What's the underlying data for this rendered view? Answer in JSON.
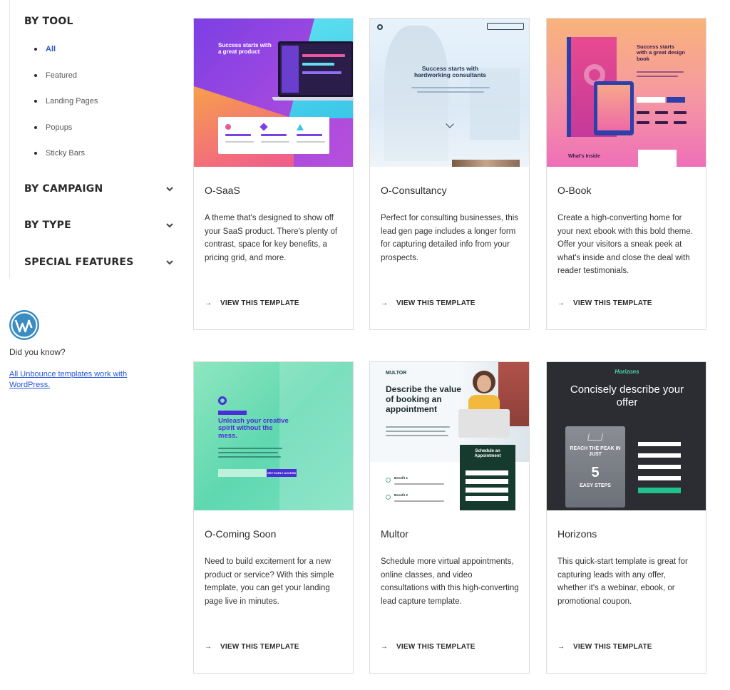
{
  "sidebar": {
    "by_tool": {
      "title": "BY TOOL",
      "items": [
        "All",
        "Featured",
        "Landing Pages",
        "Popups",
        "Sticky Bars"
      ]
    },
    "sections": [
      "BY CAMPAIGN",
      "BY TYPE",
      "SPECIAL FEATURES"
    ]
  },
  "promo": {
    "heading": "Did you know?",
    "link": "All Unbounce templates work with WordPress."
  },
  "colors": {
    "link_blue": "#2a57d6",
    "border": "#dcdcdc"
  },
  "cards": [
    {
      "title": "O-SaaS",
      "desc": "A theme that's designed to show off your SaaS product. There's plenty of contrast, space for key benefits, a pricing grid, and more.",
      "link": "VIEW THIS TEMPLATE",
      "thumb": {
        "headline": "Success starts with a great product"
      }
    },
    {
      "title": "O-Consultancy",
      "desc": "Perfect for consulting businesses, this lead gen page includes a longer form for capturing detailed info from your prospects.",
      "link": "VIEW THIS TEMPLATE",
      "thumb": {
        "headline": "Success starts with hardworking consultants"
      }
    },
    {
      "title": "O-Book",
      "desc": "Create a high-converting home for your next ebook with this bold theme. Offer your visitors a sneak peek at what's inside and close the deal with reader testimonials.",
      "link": "VIEW THIS TEMPLATE",
      "thumb": {
        "headline": "Success starts with a great design book",
        "sub": "What's Inside"
      }
    },
    {
      "title": "O-Coming Soon",
      "desc": "Need to build excitement for a new product or service? With this simple template, you can get your landing page live in minutes.",
      "link": "VIEW THIS TEMPLATE",
      "thumb": {
        "headline": "Unleash your creative spirit without the mess.",
        "button": "GET EARLY ACCESS"
      }
    },
    {
      "title": "Multor",
      "desc": "Schedule more virtual appointments, online classes, and video consultations with this high-converting lead capture template.",
      "link": "VIEW THIS TEMPLATE",
      "thumb": {
        "logo": "MULTOR",
        "headline": "Describe the value of booking an appointment",
        "form_title": "Schedule an Appointment",
        "benefit1": "Benefit 1",
        "benefit2": "Benefit 2"
      }
    },
    {
      "title": "Horizons",
      "desc": "This quick-start template is great for capturing leads with any offer, whether it's a webinar, ebook, or promotional coupon.",
      "link": "VIEW THIS TEMPLATE",
      "thumb": {
        "logo": "Horizons",
        "headline": "Concisely describe your offer",
        "book_top": "REACH THE PEAK IN JUST",
        "book_num": "5",
        "book_bottom": "EASY STEPS"
      }
    }
  ]
}
